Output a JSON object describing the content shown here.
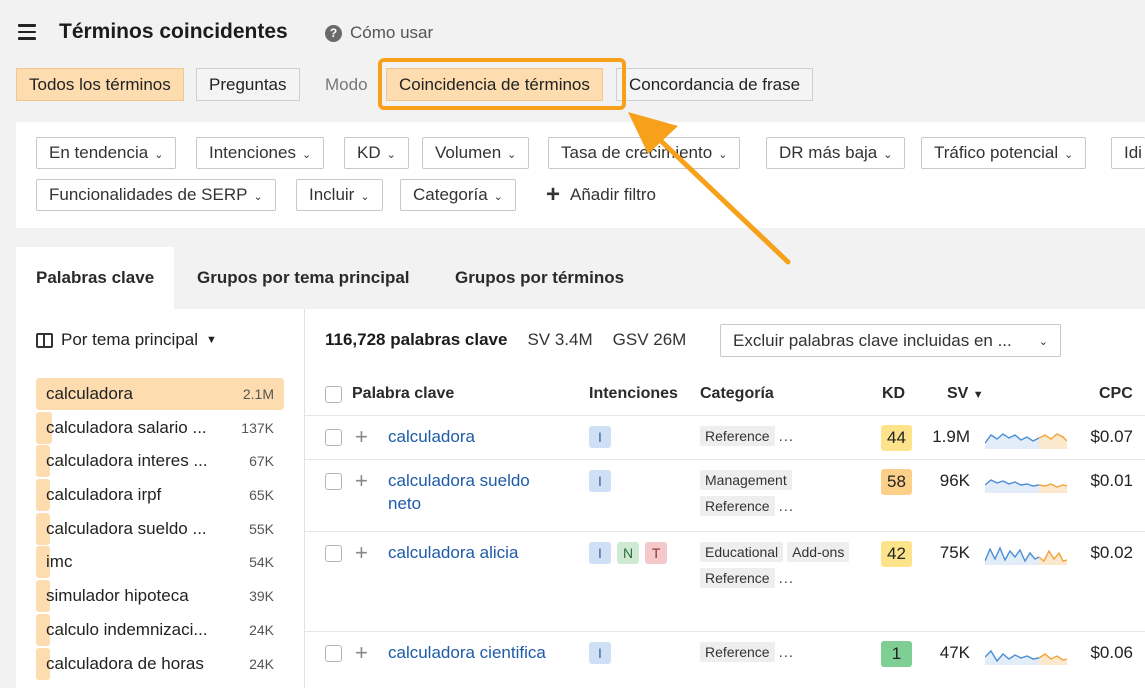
{
  "header": {
    "title": "Términos coincidentes",
    "help_label": "Cómo usar"
  },
  "mode_row": {
    "segment_all": "Todos los términos",
    "segment_questions": "Preguntas",
    "mode_label": "Modo",
    "mode_terms": "Coincidencia de términos",
    "mode_phrase": "Concordancia de frase"
  },
  "filters": {
    "row1": [
      "En tendencia",
      "Intenciones",
      "KD",
      "Volumen",
      "Tasa de crecimiento",
      "DR más baja",
      "Tráfico potencial",
      "Idi"
    ],
    "row2": [
      "Funcionalidades de SERP",
      "Incluir",
      "Categoría"
    ],
    "add_filter": "Añadir filtro"
  },
  "tabs": [
    "Palabras clave",
    "Grupos por tema principal",
    "Grupos por términos"
  ],
  "sidebar": {
    "header": "Por tema principal",
    "items": [
      {
        "label": "calculadora",
        "count": "2.1M",
        "fill": 1.0
      },
      {
        "label": "calculadora salario ...",
        "count": "137K",
        "fill": 0.065
      },
      {
        "label": "calculadora interes ...",
        "count": "67K",
        "fill": 0.032
      },
      {
        "label": "calculadora irpf",
        "count": "65K",
        "fill": 0.031
      },
      {
        "label": "calculadora sueldo ...",
        "count": "55K",
        "fill": 0.026
      },
      {
        "label": "imc",
        "count": "54K",
        "fill": 0.026
      },
      {
        "label": "simulador hipoteca",
        "count": "39K",
        "fill": 0.019
      },
      {
        "label": "calculo indemnizaci...",
        "count": "24K",
        "fill": 0.012
      },
      {
        "label": "calculadora de horas",
        "count": "24K",
        "fill": 0.012
      }
    ]
  },
  "summary": {
    "count": "116,728 palabras clave",
    "sv": "SV 3.4M",
    "gsv": "GSV 26M",
    "exclude": "Excluir palabras clave incluidas en ..."
  },
  "table": {
    "headers": {
      "keyword": "Palabra clave",
      "intents": "Intenciones",
      "category": "Categoría",
      "kd": "KD",
      "sv": "SV",
      "cpc": "CPC"
    },
    "rows": [
      {
        "keyword_lines": [
          "calculadora"
        ],
        "intents": [
          "I"
        ],
        "categories": [
          "Reference"
        ],
        "more": "...",
        "kd": "44",
        "kd_color": "#fde38a",
        "sv": "1.9M",
        "cpc": "$0.07"
      },
      {
        "keyword_lines": [
          "calculadora sueldo",
          "neto"
        ],
        "intents": [
          "I"
        ],
        "categories": [
          "Management",
          "Reference"
        ],
        "more": "...",
        "kd": "58",
        "kd_color": "#fdd08a",
        "sv": "96K",
        "cpc": "$0.01"
      },
      {
        "keyword_lines": [
          "calculadora alicia"
        ],
        "intents": [
          "I",
          "N",
          "T"
        ],
        "categories": [
          "Educational",
          "Add-ons",
          "Reference"
        ],
        "more": "...",
        "kd": "42",
        "kd_color": "#fde38a",
        "sv": "75K",
        "cpc": "$0.02"
      },
      {
        "keyword_lines": [
          "calculadora cientifica"
        ],
        "intents": [
          "I"
        ],
        "categories": [
          "Reference"
        ],
        "more": "...",
        "kd": "1",
        "kd_color": "#7fcf95",
        "sv": "47K",
        "cpc": "$0.06"
      }
    ]
  },
  "colors": {
    "accent_orange": "#f7a11b",
    "active_fill": "#fddcb0",
    "link_blue": "#1e5ba8",
    "spark_blue": "#4a8fd6",
    "spark_orange": "#f2a33a"
  }
}
